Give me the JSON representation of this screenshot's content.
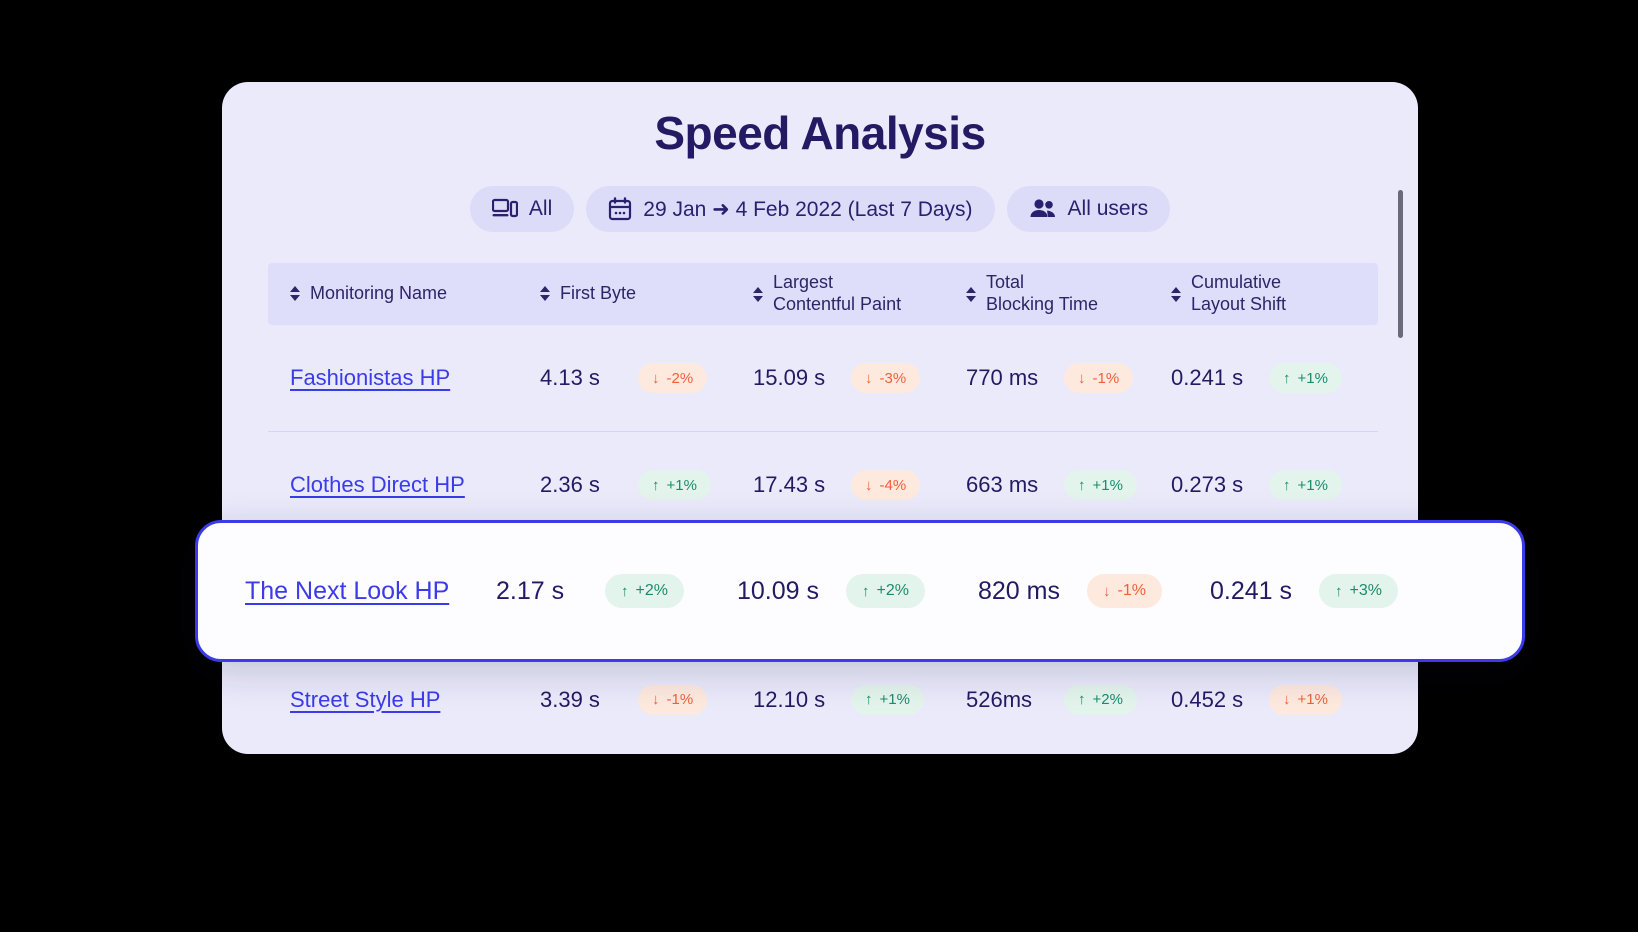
{
  "header": {
    "title": "Speed Analysis"
  },
  "filters": [
    {
      "label": "All",
      "icon": "devices-icon"
    },
    {
      "label": "29 Jan ➜ 4 Feb 2022 (Last 7 Days)",
      "icon": "calendar-icon"
    },
    {
      "label": "All users",
      "icon": "users-icon"
    }
  ],
  "table": {
    "columns": [
      {
        "label": "Monitoring Name",
        "icon": "sort-icon"
      },
      {
        "label": "First Byte",
        "icon": "sort-icon"
      },
      {
        "label": "Largest\nContentful Paint",
        "icon": "sort-icon"
      },
      {
        "label": "Total\nBlocking Time",
        "icon": "sort-icon"
      },
      {
        "label": "Cumulative\nLayout Shift",
        "icon": "sort-icon"
      }
    ],
    "rows": [
      {
        "name": "Fashionistas HP",
        "first_byte": {
          "value": "4.13 s",
          "delta": "-2%",
          "dir": "down"
        },
        "lcp": {
          "value": "15.09 s",
          "delta": "-3%",
          "dir": "down"
        },
        "tbt": {
          "value": "770 ms",
          "delta": "-1%",
          "dir": "down"
        },
        "cls": {
          "value": "0.241 s",
          "delta": "+1%",
          "dir": "up"
        }
      },
      {
        "name": "Clothes Direct HP",
        "first_byte": {
          "value": "2.36 s",
          "delta": "+1%",
          "dir": "up"
        },
        "lcp": {
          "value": "17.43 s",
          "delta": "-4%",
          "dir": "down"
        },
        "tbt": {
          "value": "663 ms",
          "delta": "+1%",
          "dir": "up"
        },
        "cls": {
          "value": "0.273 s",
          "delta": "+1%",
          "dir": "up"
        }
      },
      {
        "name": "The Next Look HP",
        "first_byte": {
          "value": "2.17 s",
          "delta": "+2%",
          "dir": "up"
        },
        "lcp": {
          "value": "10.09 s",
          "delta": "+2%",
          "dir": "up"
        },
        "tbt": {
          "value": "820 ms",
          "delta": "-1%",
          "dir": "down"
        },
        "cls": {
          "value": "0.241 s",
          "delta": "+3%",
          "dir": "up"
        }
      },
      {
        "name": "Street Style HP",
        "first_byte": {
          "value": "3.39 s",
          "delta": "-1%",
          "dir": "down"
        },
        "lcp": {
          "value": "12.10 s",
          "delta": "+1%",
          "dir": "up"
        },
        "tbt": {
          "value": "526ms",
          "delta": "+2%",
          "dir": "up"
        },
        "cls": {
          "value": "0.452 s",
          "delta": "+1%",
          "dir": "down"
        }
      }
    ]
  },
  "highlighted_row_index": 2,
  "colors": {
    "card_bg": "#eaeafb",
    "header_bg": "#dedefb",
    "title": "#231a63",
    "link": "#3b3bea",
    "accent": "#3b3bea",
    "positive": "#1d8a6e",
    "positive_bg": "#e3f4ec",
    "negative": "#f2603c",
    "negative_bg": "#fde9de",
    "pill_bg": "#dcdcf8"
  },
  "icons": {
    "sort_up": "▲",
    "sort_down": "▼",
    "arrow_up": "↑",
    "arrow_down": "↓"
  }
}
